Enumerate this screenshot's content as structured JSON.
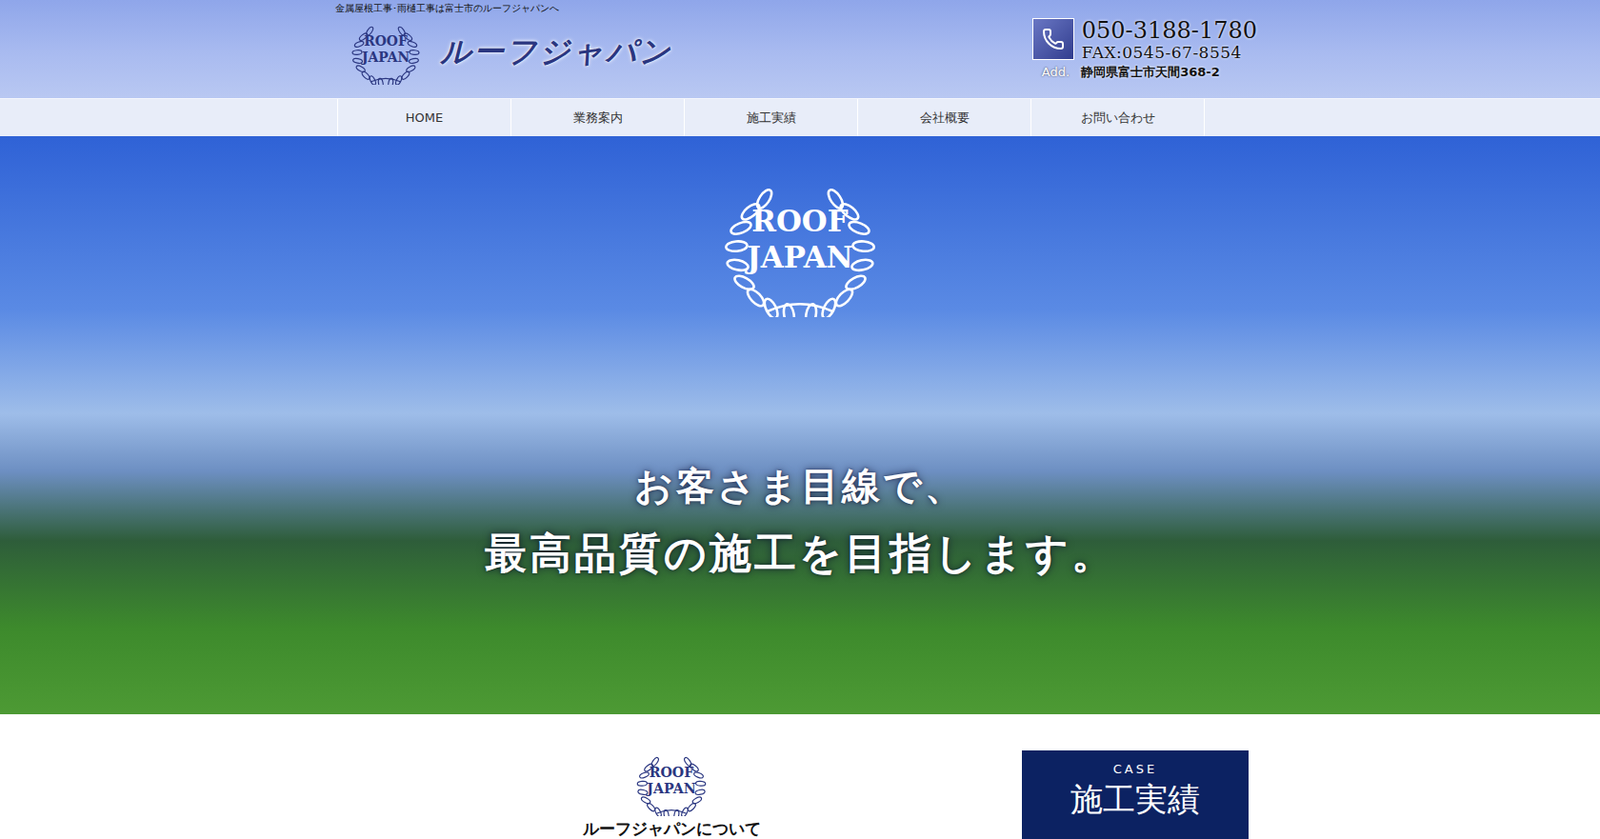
{
  "header": {
    "tagline": "金属屋根工事･雨樋工事は富士市のルーフジャパンへ",
    "brand": "ルーフジャパン",
    "logo": [
      "ROOF",
      "JAPAN"
    ],
    "tel": "050-3188-1780",
    "fax": "FAX:0545-67-8554",
    "address_label": "Add.",
    "address": "静岡県富士市天間368-2"
  },
  "nav": [
    {
      "label": "HOME",
      "selected": false
    },
    {
      "label": "業務案内",
      "selected": false
    },
    {
      "label": "施工実績",
      "selected": false
    },
    {
      "label": "会社概要",
      "selected": false
    },
    {
      "label": "お問い合わせ",
      "selected": false
    }
  ],
  "hero": {
    "logo": [
      "ROOF",
      "JAPAN"
    ],
    "lines": [
      "お客さま目線で、",
      "最高品質の施工を目指します。"
    ]
  },
  "about": {
    "logo": [
      "ROOF",
      "JAPAN"
    ],
    "heading": "ルーフジャパンについて"
  },
  "case_box": {
    "eyebrow": "CASE",
    "title": "施工実績"
  }
}
